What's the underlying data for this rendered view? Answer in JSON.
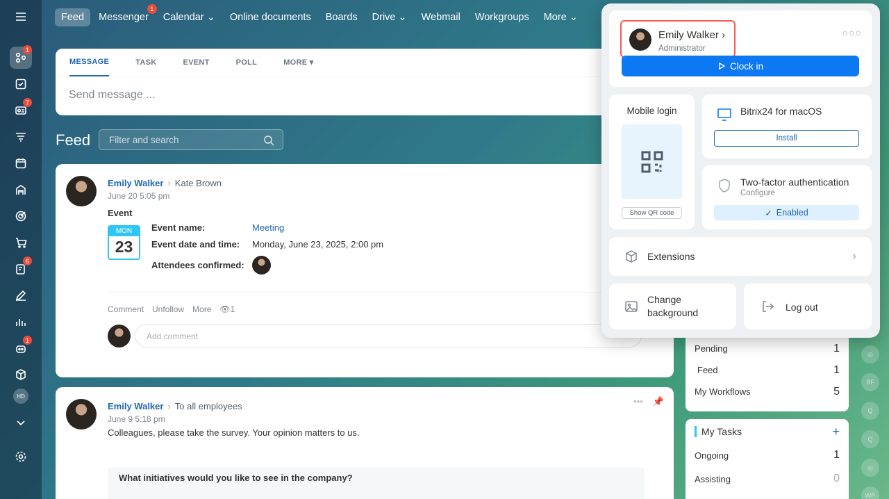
{
  "nav": {
    "items": [
      {
        "label": "Feed"
      },
      {
        "label": "Messenger",
        "badge": "1"
      },
      {
        "label": "Calendar ⌄"
      },
      {
        "label": "Online documents"
      },
      {
        "label": "Boards"
      },
      {
        "label": "Drive ⌄"
      },
      {
        "label": "Webmail"
      },
      {
        "label": "Workgroups"
      },
      {
        "label": "More ⌄"
      }
    ]
  },
  "sidebar": {
    "badges": {
      "chat": "1",
      "contacts": "7",
      "tasks": "6",
      "robot": "1"
    },
    "avatar_initials": "HD"
  },
  "composer": {
    "tabs": [
      "MESSAGE",
      "TASK",
      "EVENT",
      "POLL",
      "MORE"
    ],
    "placeholder": "Send message ..."
  },
  "feed": {
    "title": "Feed",
    "filter_placeholder": "Filter and search"
  },
  "post1": {
    "author": "Emily Walker",
    "recipient": "Kate Brown",
    "date": "June 20 5:05 pm",
    "kind": "Event",
    "calendar_month": "MON",
    "calendar_day": "23",
    "event_name_label": "Event name:",
    "event_name_value": "Meeting",
    "event_date_label": "Event date and time:",
    "event_date_value": "Monday, June 23, 2025, 2:00 pm",
    "attendees_label": "Attendees confirmed:",
    "actions": [
      "Comment",
      "Unfollow",
      "More"
    ],
    "views": "1",
    "comment_placeholder": "Add comment"
  },
  "post2": {
    "author": "Emily Walker",
    "recipient": "To all employees",
    "date": "June 9 5:18 pm",
    "text": "Colleagues, please take the survey. Your opinion matters to us.",
    "survey_question": "What initiatives would you like to see in the company?"
  },
  "workflows": {
    "rows": [
      {
        "label": "Pending",
        "value": "1"
      },
      {
        "label": "Feed",
        "value": "1"
      },
      {
        "label": "My Workflows",
        "value": "5"
      }
    ]
  },
  "tasks": {
    "title": "My Tasks",
    "rows": [
      {
        "label": "Ongoing",
        "value": "1"
      },
      {
        "label": "Assisting",
        "value": "0"
      }
    ]
  },
  "right_strip": [
    "BF",
    "Q",
    "Q",
    "WP"
  ],
  "panel": {
    "user_name": "Emily Walker",
    "user_role": "Administrator",
    "clock_in": "Clock in",
    "mobile_login": "Mobile login",
    "show_qr": "Show QR code",
    "desktop_app": "Bitrix24 for macOS",
    "install": "Install",
    "twofa_title": "Two-factor authentication",
    "twofa_sub": "Configure",
    "enabled": "Enabled",
    "extensions": "Extensions",
    "change_bg": "Change background",
    "logout": "Log out"
  }
}
